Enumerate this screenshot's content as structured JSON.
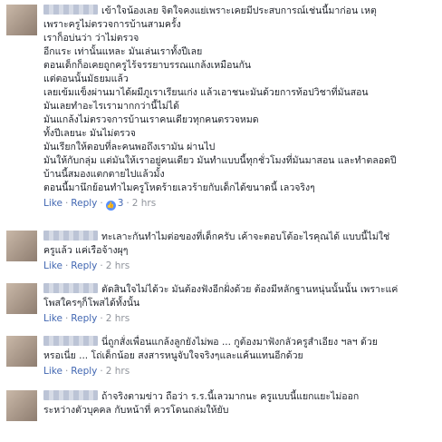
{
  "ui": {
    "like_label": "Like",
    "reply_label": "Reply",
    "separator": "·"
  },
  "comments": [
    {
      "lines": [
        "เข้าใจน้องเลย จิตใจคงแย่เพราะเคยมีประสบการณ์เช่นนี้มาก่อน เหตุ",
        "เพราะครูไม่ตรวจการบ้านสามครั้ง",
        "เราก็อบ่นว่า ว่าไม่ตรวจ",
        "อีกแระ เท่านั้นแหละ มันเล่นเราทั้งปีเลย",
        "ตอนเด็กก็อเคยถูกครูไร้จรรยาบรรณแกล้งเหมือนกัน",
        "แต่ตอนนั้นมัธยมแล้ว",
        "เลยเข้มแข็งผ่านมาได้ผมีภูเราเรียนเก่ง แล้วเอาชนะมันด้วยการท้อปวิชาที่มันสอน",
        "มันเลยทำอะไรเรามากกว่านี้ไม่ได้",
        "มันแกล้งไม่ตรวจการบ้านเราคนเดียวทุกคนตรวจหมด",
        "ทั้งปีเลยนะ มันไม่ตรวจ",
        "มันเรียกให้ตอบที่ละคนพอถึงเรามัน ผ่านไป",
        "มันให้กับกลุ่ม แต่มันให้เราอยู่คนเดียว มันทำแบบนี้ทุกชั่วโมงที่มันมาสอน และทำตลอดปี",
        "บ้านนี้สมองแตกตายไปแล้วมั้ง",
        "ตอนนี้มานึกย้อนทำไมครูโหดร้ายเลวร้ายกับเด็กได้ขนาดนี้ เลวจริงๆ"
      ],
      "reactions": "3",
      "time": "2 hrs"
    },
    {
      "lines": [
        "ทะเลาะกันทำไมต่อของที่เด็กครับ เค้าจะตอบโต้อะไรคุณได้ แบบนี้ไม่ใช่",
        "ครูแล้ว แค่เรือจ้างผุๆ"
      ],
      "time": "2 hrs"
    },
    {
      "lines": [
        "ตัดสินใจไม่ได้วะ มันต้องฟังอีกฝั่งด้วย ต้องมีหลักฐานหนุ่นนั้นนั้น เพราะแค่",
        "โพสใครๆก็โพสได้ทั้งนั้น"
      ],
      "time": "2 hrs"
    },
    {
      "lines": [
        "นี่ถูกสั่งเพื่อนแกล้งลูกยังไม่พอ ... กูต้องมาฟังกลัวครูสำเอียง ฯลฯ ด้วย",
        "หรอเนี่ย ... โถ่เด็กน้อย สงสารหนูจับใจจริงๆและแค้นแทนอีกด้วย"
      ],
      "time": "2 hrs"
    },
    {
      "lines": [
        "ถ้าจริงตามข่าว ถือว่า ร.ร.นี้เลวมากนะ ครูแบบนี้แยกแยะไม่ออก",
        "ระหว่างตัวบุคคล กับหน้าที่ ควรโดนถล่มให้ยับ"
      ]
    }
  ]
}
